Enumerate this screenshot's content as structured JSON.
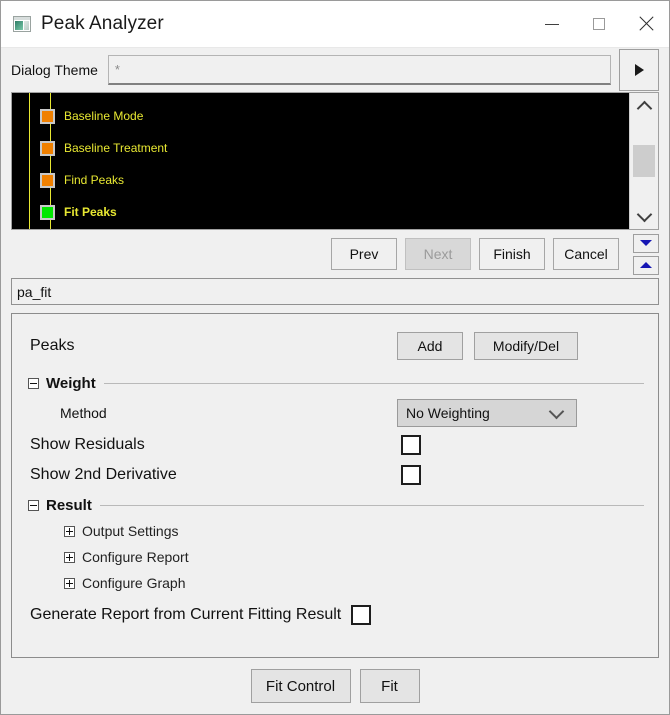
{
  "window": {
    "title": "Peak Analyzer",
    "icon": "peak-analyzer-icon",
    "controls": {
      "minimize": "minimize-icon",
      "maximize": "maximize-icon",
      "close": "close-icon"
    }
  },
  "theme": {
    "label": "Dialog Theme",
    "value": "*",
    "placeholder": "*",
    "expand_button": "triangle-right-icon"
  },
  "tree": {
    "items": [
      {
        "label": "Baseline Mode",
        "state": "orange",
        "current": false
      },
      {
        "label": "Baseline Treatment",
        "state": "orange",
        "current": false
      },
      {
        "label": "Find Peaks",
        "state": "orange",
        "current": false
      },
      {
        "label": "Fit Peaks",
        "state": "green",
        "current": true
      }
    ],
    "colors": {
      "background": "#000000",
      "text": "#e8e832",
      "done_node": "#f08000",
      "current_node": "#00e800",
      "connector": "#e8e832"
    }
  },
  "nav": {
    "prev": "Prev",
    "next": "Next",
    "next_disabled": true,
    "finish": "Finish",
    "cancel": "Cancel",
    "spin_down": "triangle-down-icon",
    "spin_up": "triangle-up-icon"
  },
  "name_field": {
    "value": "pa_fit"
  },
  "settings": {
    "peaks": {
      "label": "Peaks",
      "add": "Add",
      "modify_del": "Modify/Del"
    },
    "weight": {
      "title": "Weight",
      "expanded": true,
      "method_label": "Method",
      "method_value": "No Weighting",
      "method_options": [
        "No Weighting"
      ]
    },
    "show_residuals": {
      "label": "Show Residuals",
      "checked": false
    },
    "show_2nd_derivative": {
      "label": "Show 2nd Derivative",
      "checked": false
    },
    "result": {
      "title": "Result",
      "expanded": true,
      "sub_items": [
        "Output Settings",
        "Configure Report",
        "Configure Graph"
      ]
    },
    "generate_report": {
      "label": "Generate Report from Current Fitting Result",
      "checked": false
    }
  },
  "footer": {
    "fit_control": "Fit Control",
    "fit": "Fit"
  }
}
